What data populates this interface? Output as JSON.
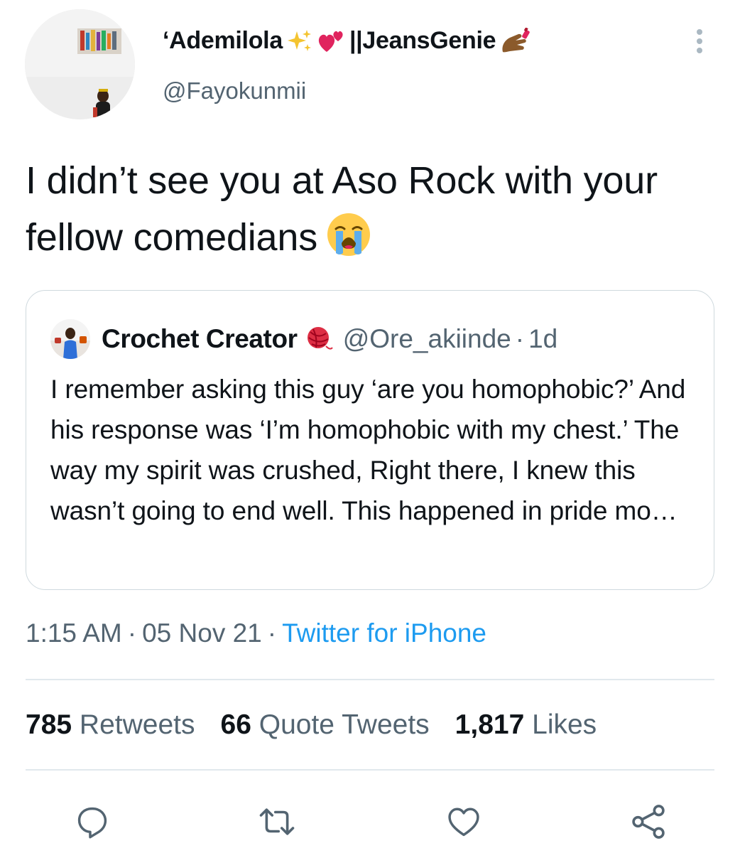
{
  "tweet": {
    "author": {
      "name": "‘Ademilola",
      "name_suffix": "||JeansGenie",
      "handle": "@Fayokunmii"
    },
    "text": "I didn’t see you at Aso Rock with your fellow comedians",
    "timestamp": "1:15 AM",
    "date": "05 Nov 21",
    "separator": "·",
    "source": "Twitter for iPhone"
  },
  "quote": {
    "author_name": "Crochet Creator",
    "handle": "@Ore_akiinde",
    "separator": "·",
    "age": "1d",
    "text": "I remember asking this guy ‘are you homophobic?’ And his response was ‘I’m homophobic with my chest.’ The way my spirit was crushed, Right there, I knew this wasn’t going to end well. This happened in pride mo…"
  },
  "stats": {
    "retweets": {
      "count": "785",
      "label": "Retweets"
    },
    "quote_tweets": {
      "count": "66",
      "label": "Quote Tweets"
    },
    "likes": {
      "count": "1,817",
      "label": "Likes"
    }
  },
  "icons": {
    "reply": "reply-icon",
    "retweet": "retweet-icon",
    "like": "heart-icon",
    "share": "share-icon",
    "more": "more-vertical-icon"
  },
  "colors": {
    "text": "#0f1419",
    "secondary": "#536471",
    "link": "#1d9bf0",
    "border": "#cfd9de"
  }
}
